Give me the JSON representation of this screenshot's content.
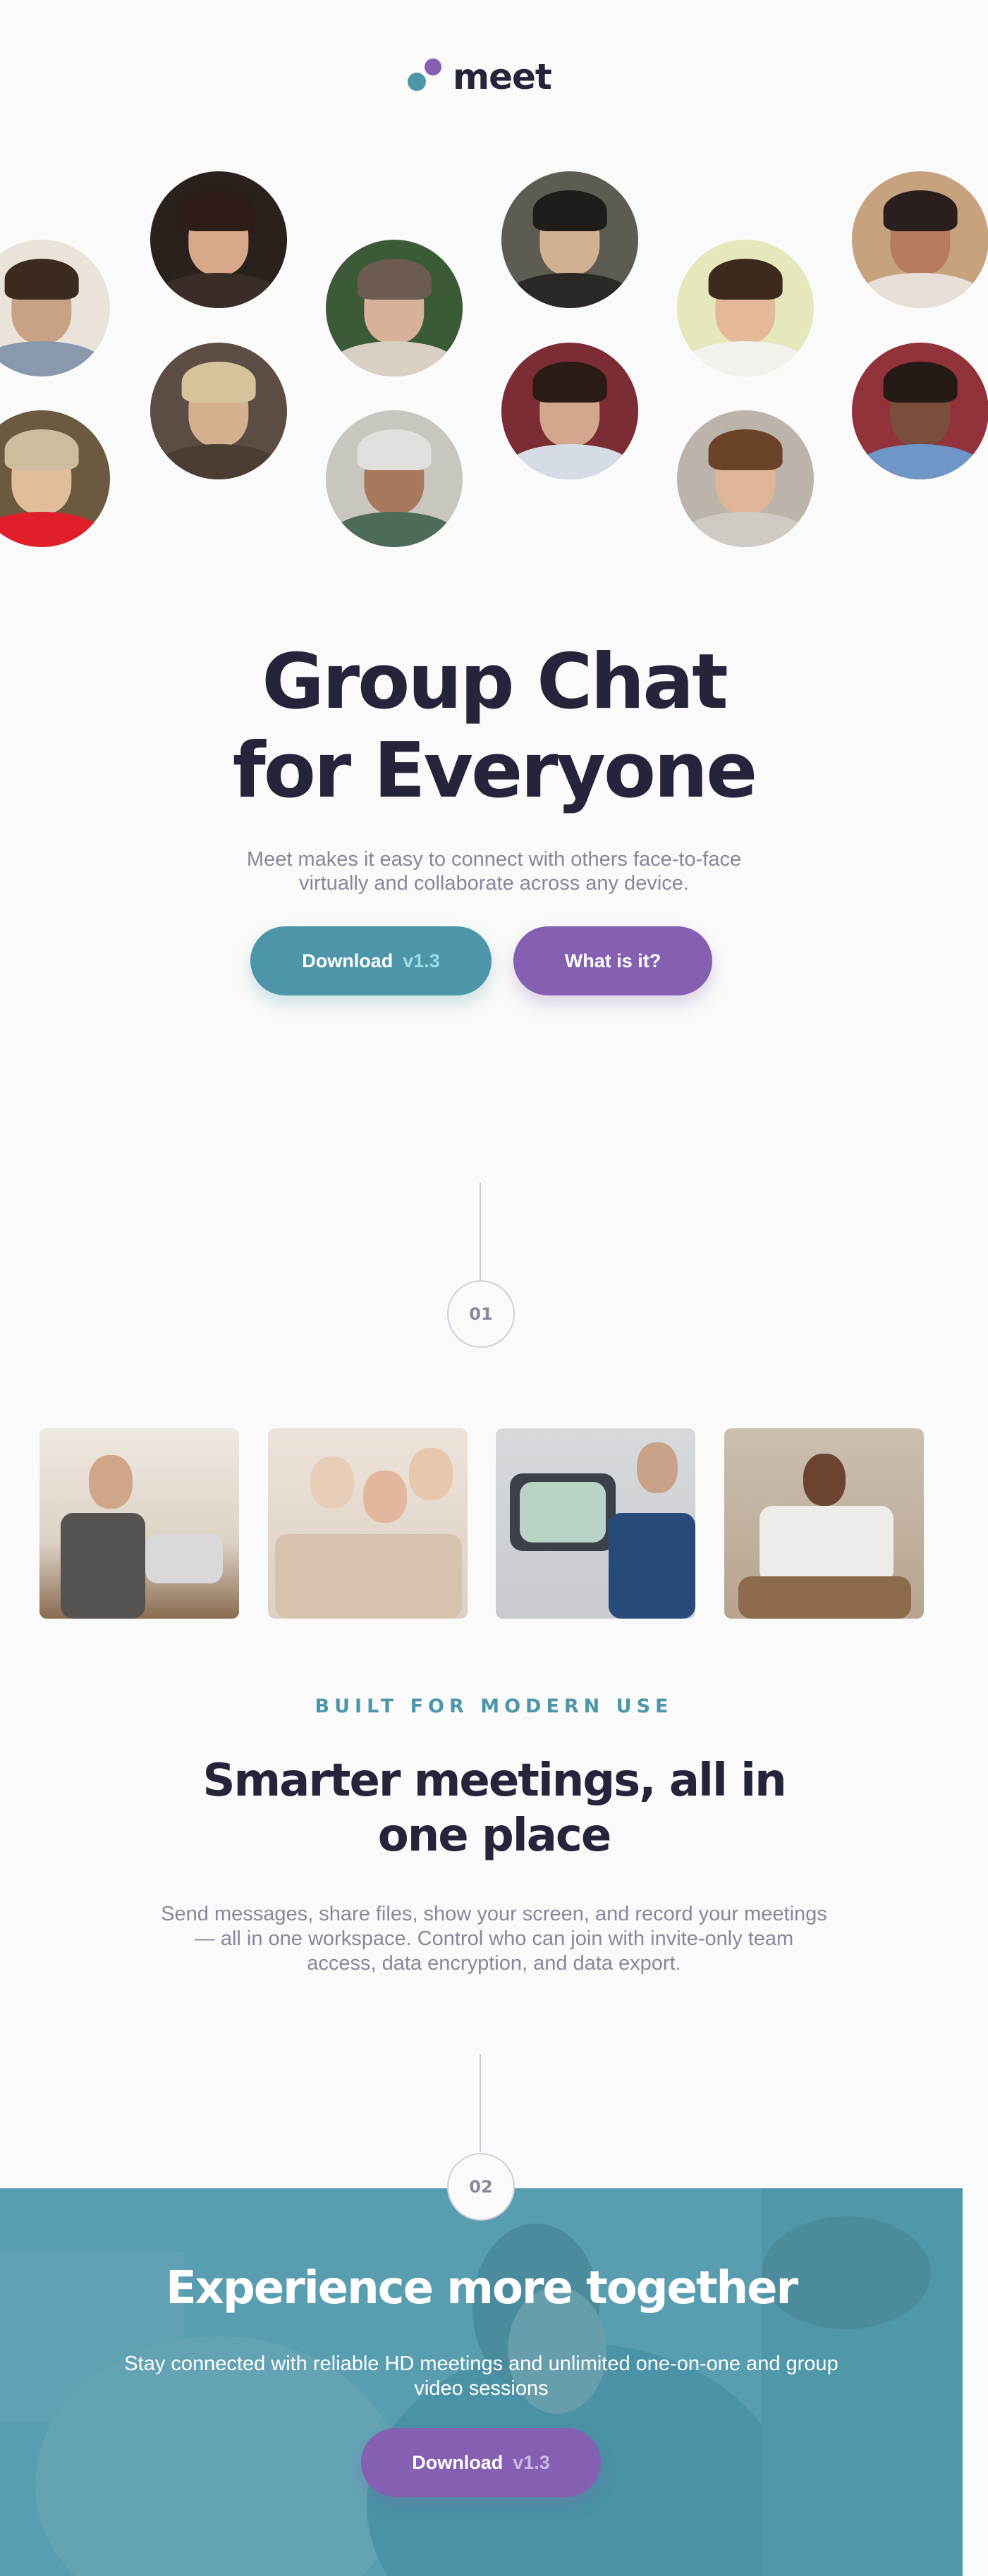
{
  "brand": {
    "name": "meet",
    "colors": {
      "teal": "#4D96A9",
      "purple": "#855FB1",
      "dark": "#24243A",
      "gray": "#87879D"
    }
  },
  "avatars": [
    {
      "name": "avatar-1",
      "icon": "person-avatar"
    },
    {
      "name": "avatar-2",
      "icon": "person-avatar"
    },
    {
      "name": "avatar-3",
      "icon": "person-avatar"
    },
    {
      "name": "avatar-4",
      "icon": "person-avatar"
    },
    {
      "name": "avatar-5",
      "icon": "person-avatar"
    },
    {
      "name": "avatar-6",
      "icon": "person-avatar"
    },
    {
      "name": "avatar-7",
      "icon": "person-avatar"
    },
    {
      "name": "avatar-8",
      "icon": "person-avatar"
    },
    {
      "name": "avatar-9",
      "icon": "person-avatar"
    },
    {
      "name": "avatar-10",
      "icon": "person-avatar"
    },
    {
      "name": "avatar-11",
      "icon": "person-avatar"
    },
    {
      "name": "avatar-12",
      "icon": "person-avatar"
    }
  ],
  "hero": {
    "title_line1": "Group Chat",
    "title_line2": "for Everyone",
    "subtitle": "Meet makes it easy to connect with others face-to-face virtually and collaborate across any device.",
    "download_label": "Download",
    "download_version": "v1.3",
    "what_label": "What is it?"
  },
  "steps": {
    "one": "01",
    "two": "02"
  },
  "gallery": [
    {
      "name": "photo-woman-laptop",
      "icon": "photo"
    },
    {
      "name": "photo-women-phone",
      "icon": "photo"
    },
    {
      "name": "photo-video-call",
      "icon": "photo"
    },
    {
      "name": "photo-man-phone",
      "icon": "photo"
    }
  ],
  "features": {
    "eyebrow": "BUILT FOR MODERN USE",
    "title_line1": "Smarter meetings, all in",
    "title_line2": "one place",
    "text": "Send messages, share files, show your screen, and record your meetings — all in one workspace. Control who can join with invite-only team access, data encryption, and data export."
  },
  "cta": {
    "title": "Experience more together",
    "text": "Stay connected with reliable HD meetings and unlimited one-on-one and group video sessions",
    "download_label": "Download",
    "download_version": "v1.3"
  }
}
